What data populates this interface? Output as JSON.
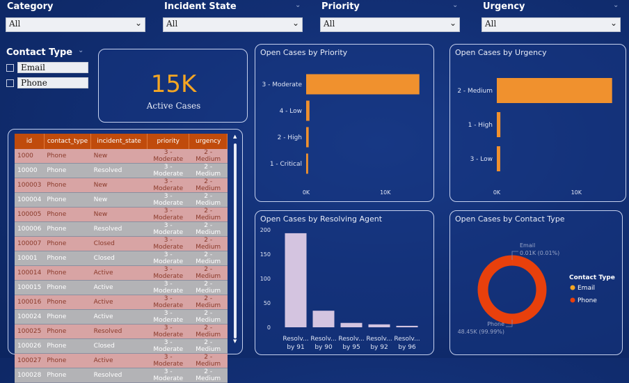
{
  "slicers": [
    {
      "title": "Category",
      "value": "All"
    },
    {
      "title": "Incident State",
      "value": "All"
    },
    {
      "title": "Priority",
      "value": "All"
    },
    {
      "title": "Urgency",
      "value": "All"
    }
  ],
  "contact_type_slicer": {
    "title": "Contact Type",
    "options": [
      "Email",
      "Phone"
    ]
  },
  "kpi": {
    "value": "15K",
    "label": "Active Cases"
  },
  "table": {
    "headers": [
      "id",
      "contact_type",
      "incident_state",
      "priority",
      "urgency"
    ],
    "rows": [
      [
        "1000",
        "Phone",
        "New",
        "3 - Moderate",
        "2 - Medium"
      ],
      [
        "10000",
        "Phone",
        "Resolved",
        "3 - Moderate",
        "2 - Medium"
      ],
      [
        "100003",
        "Phone",
        "New",
        "3 - Moderate",
        "2 - Medium"
      ],
      [
        "100004",
        "Phone",
        "New",
        "3 - Moderate",
        "2 - Medium"
      ],
      [
        "100005",
        "Phone",
        "New",
        "3 - Moderate",
        "2 - Medium"
      ],
      [
        "100006",
        "Phone",
        "Resolved",
        "3 - Moderate",
        "2 - Medium"
      ],
      [
        "100007",
        "Phone",
        "Closed",
        "3 - Moderate",
        "2 - Medium"
      ],
      [
        "10001",
        "Phone",
        "Closed",
        "3 - Moderate",
        "2 - Medium"
      ],
      [
        "100014",
        "Phone",
        "Active",
        "3 - Moderate",
        "2 - Medium"
      ],
      [
        "100015",
        "Phone",
        "Active",
        "3 - Moderate",
        "2 - Medium"
      ],
      [
        "100016",
        "Phone",
        "Active",
        "3 - Moderate",
        "2 - Medium"
      ],
      [
        "100024",
        "Phone",
        "Active",
        "3 - Moderate",
        "2 - Medium"
      ],
      [
        "100025",
        "Phone",
        "Resolved",
        "3 - Moderate",
        "2 - Medium"
      ],
      [
        "100026",
        "Phone",
        "Closed",
        "3 - Moderate",
        "2 - Medium"
      ],
      [
        "100027",
        "Phone",
        "Active",
        "3 - Moderate",
        "2 - Medium"
      ],
      [
        "100028",
        "Phone",
        "Resolved",
        "3 - Moderate",
        "2 - Medium"
      ]
    ]
  },
  "chart_data": [
    {
      "type": "bar",
      "orientation": "horizontal",
      "title": "Open Cases by Priority",
      "categories": [
        "3 - Moderate",
        "4 - Low",
        "2 - High",
        "1 - Critical"
      ],
      "values": [
        14300,
        420,
        320,
        250
      ],
      "xlim": [
        0,
        14500
      ],
      "ticks": [
        "0K",
        "10K"
      ],
      "tick_values": [
        0,
        10000
      ],
      "color": "#f0912e"
    },
    {
      "type": "bar",
      "orientation": "horizontal",
      "title": "Open Cases by Urgency",
      "categories": [
        "2 - Medium",
        "1 - High",
        "3 - Low"
      ],
      "values": [
        14500,
        450,
        430
      ],
      "xlim": [
        0,
        14700
      ],
      "ticks": [
        "0K",
        "10K"
      ],
      "tick_values": [
        0,
        10000
      ],
      "color": "#f0912e"
    },
    {
      "type": "bar",
      "orientation": "vertical",
      "title": "Open Cases by Resolving Agent",
      "categories": [
        "Resolv... by 91",
        "Resolv... by 90",
        "Resolv... by 95",
        "Resolv... by 92",
        "Resolv... by 96"
      ],
      "values": [
        193,
        34,
        9,
        6,
        3
      ],
      "ylim": [
        0,
        200
      ],
      "ticks": [
        "0",
        "50",
        "100",
        "150",
        "200"
      ],
      "tick_values": [
        0,
        50,
        100,
        150,
        200
      ],
      "color": "#d4c4e0"
    },
    {
      "type": "pie",
      "variant": "donut",
      "title": "Open Cases by Contact Type",
      "legend_title": "Contact Type",
      "slices": [
        {
          "name": "Email",
          "value": 0.01,
          "label": "0.01K (0.01%)",
          "color": "#f5a623"
        },
        {
          "name": "Phone",
          "value": 48.45,
          "label": "48.45K (99.99%)",
          "color": "#e8400c"
        }
      ],
      "legend_position": "right"
    }
  ],
  "icons": {
    "chevron": "chevron-down-icon",
    "dropdown": "dropdown-arrow-icon"
  }
}
